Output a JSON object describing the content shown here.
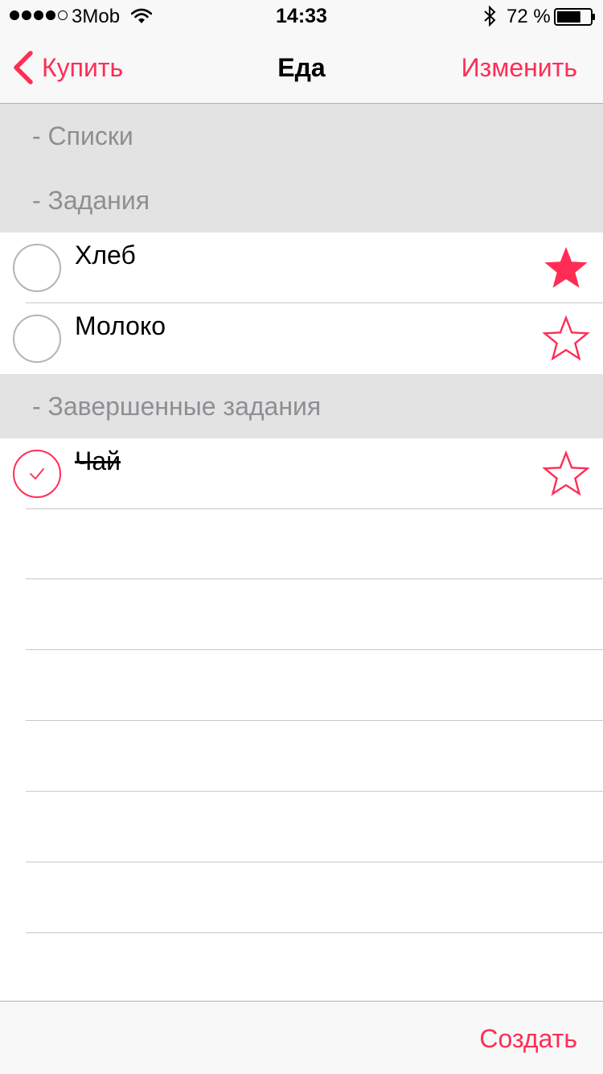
{
  "status_bar": {
    "carrier": "3Mob",
    "time": "14:33",
    "battery_percent": "72 %",
    "battery_level": 0.72,
    "signal_bars": 4,
    "signal_total": 5
  },
  "nav": {
    "back_label": "Купить",
    "title": "Еда",
    "edit_label": "Изменить"
  },
  "sections": {
    "lists_header": "- Списки",
    "tasks_header": "- Задания",
    "completed_header": "- Завершенные задания"
  },
  "tasks": [
    {
      "label": "Хлеб",
      "starred": true,
      "done": false
    },
    {
      "label": "Молоко",
      "starred": false,
      "done": false
    }
  ],
  "completed": [
    {
      "label": "Чай",
      "starred": false,
      "done": true
    }
  ],
  "toolbar": {
    "create_label": "Создать"
  },
  "colors": {
    "accent": "#ff2d55",
    "section_bg": "#e3e3e3",
    "section_text": "#8e8e93",
    "bar_bg": "#f8f8f8"
  },
  "icons": {
    "back": "chevron-left-icon",
    "star_filled": "star-filled-icon",
    "star_outline": "star-outline-icon",
    "check": "checkmark-icon"
  }
}
